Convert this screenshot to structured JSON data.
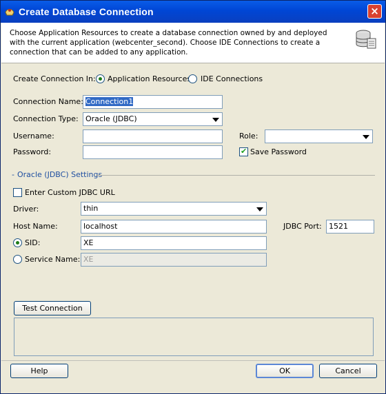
{
  "window": {
    "title": "Create Database Connection",
    "close_glyph": "×"
  },
  "header": {
    "description": "Choose Application Resources to create a database connection owned by and deployed with the current application (webcenter_second). Choose IDE Connections to create a connection that can be added to any application.",
    "icon": "database-icon"
  },
  "create_in": {
    "label": "Create Connection In:",
    "options": [
      "Application Resources",
      "IDE Connections"
    ],
    "selected": "Application Resources"
  },
  "form": {
    "connection_name_label": "Connection Name:",
    "connection_name_value": "Connection1",
    "connection_type_label": "Connection Type:",
    "connection_type_value": "Oracle (JDBC)",
    "username_label": "Username:",
    "username_value": "",
    "password_label": "Password:",
    "password_value": "",
    "role_label": "Role:",
    "role_value": "",
    "save_password_label": "Save Password",
    "save_password_checked": true
  },
  "oracle_settings": {
    "group_label": "Oracle (JDBC) Settings",
    "custom_url_label": "Enter Custom JDBC URL",
    "custom_url_checked": false,
    "driver_label": "Driver:",
    "driver_value": "thin",
    "host_label": "Host Name:",
    "host_value": "localhost",
    "port_label": "JDBC Port:",
    "port_value": "1521",
    "sid_label": "SID:",
    "sid_value": "XE",
    "service_label": "Service Name:",
    "service_value": "XE",
    "selected": "SID"
  },
  "buttons": {
    "test_connection": "Test Connection",
    "help": "Help",
    "ok": "OK",
    "cancel": "Cancel"
  },
  "colors": {
    "titlebar": "#0a5ce8",
    "dialog_bg": "#ece9d8",
    "accent_green": "#21a121"
  }
}
